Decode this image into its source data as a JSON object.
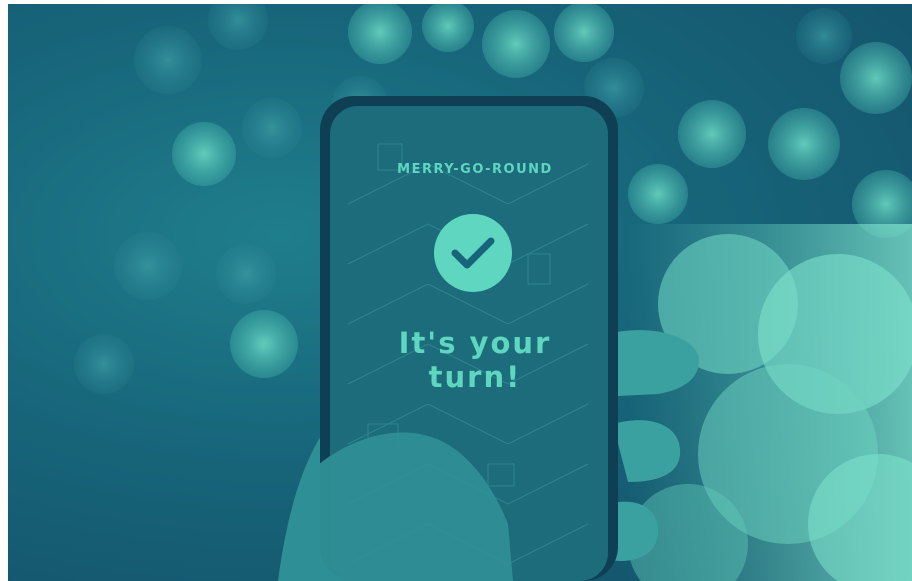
{
  "app": {
    "title": "MERRY-GO-ROUND"
  },
  "status": {
    "message": "It's your turn!",
    "icon": "checkmark-icon"
  },
  "colors": {
    "accent": "#5fd6c0",
    "background": "#17657a",
    "phone_screen": "#1c6c7b"
  }
}
